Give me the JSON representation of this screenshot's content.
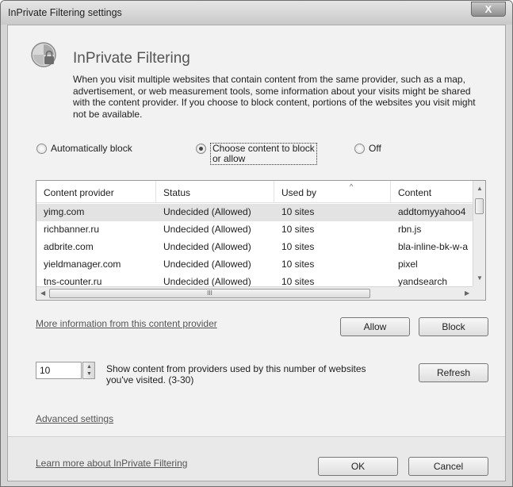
{
  "window": {
    "title": "InPrivate Filtering settings",
    "close_label": "X"
  },
  "header": {
    "icon": "inprivate-shield-icon",
    "title": "InPrivate Filtering",
    "description": "When you visit multiple websites that contain content from the same provider, such as a map, advertisement, or web measurement tools, some information about your visits might be shared with the content provider.  If you choose to block content, portions of the websites you visit might not be available."
  },
  "mode": {
    "auto_label": "Automatically block",
    "choose_label_line1": "Choose content to block",
    "choose_label_line2": "or allow",
    "off_label": "Off",
    "selected": "choose"
  },
  "table": {
    "columns": [
      "Content provider",
      "Status",
      "Used by",
      "Content"
    ],
    "rows": [
      [
        "yimg.com",
        "Undecided (Allowed)",
        "10 sites",
        "addtomyyahoo4"
      ],
      [
        "richbanner.ru",
        "Undecided (Allowed)",
        "10 sites",
        "rbn.js"
      ],
      [
        "adbrite.com",
        "Undecided (Allowed)",
        "10 sites",
        "bla-inline-bk-w-a"
      ],
      [
        "yieldmanager.com",
        "Undecided (Allowed)",
        "10 sites",
        "pixel"
      ],
      [
        "tns-counter.ru",
        "Undecided (Allowed)",
        "10 sites",
        "yandsearch"
      ]
    ],
    "selected_row": 0,
    "hscroll_grip": "III"
  },
  "more_info_link": "More information from this content provider",
  "buttons": {
    "allow": "Allow",
    "block": "Block",
    "refresh": "Refresh",
    "ok": "OK",
    "cancel": "Cancel"
  },
  "threshold": {
    "value": "10",
    "text_line1": "Show content from providers used by this number of websites",
    "text_line2": "you've visited. (3-30)"
  },
  "advanced_link": "Advanced settings",
  "learn_more_link": "Learn more about InPrivate Filtering"
}
